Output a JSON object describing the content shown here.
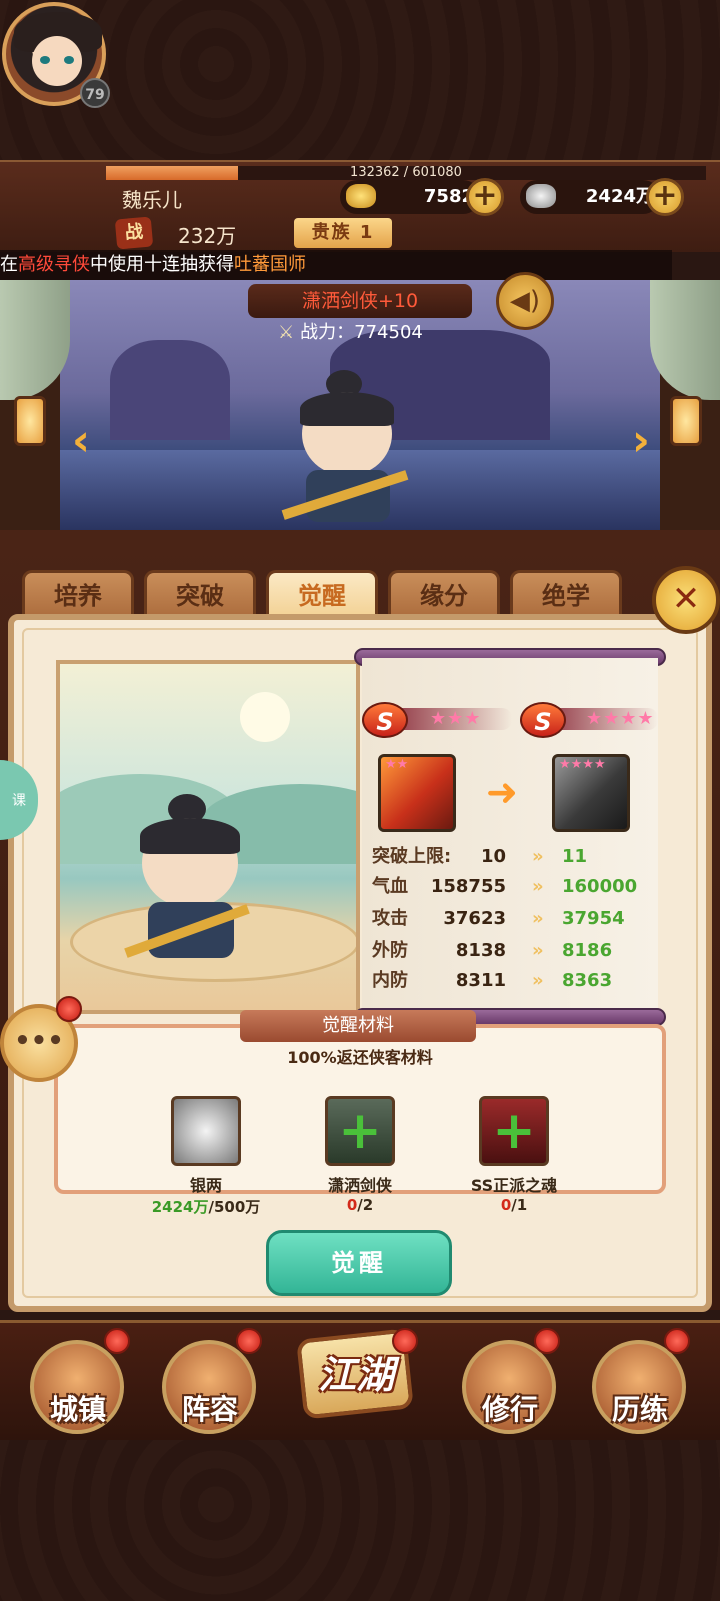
{
  "header": {
    "player_name": "魏乐儿",
    "level": "79",
    "exp_text": "132362 / 601080",
    "exp_fraction": 0.22,
    "gold_amount": "7582",
    "silver_amount": "2424万",
    "power_badge": "战",
    "power_value": "232万",
    "vip_label": "贵族 1"
  },
  "broadcast": {
    "prefix": "在",
    "location": "高级寻侠",
    "middle": "中使用十连抽获得",
    "reward": "吐蕃国师"
  },
  "hero": {
    "name_title": "潇洒剑侠+10",
    "combat_label": "战力：",
    "combat_value": "774504"
  },
  "tabs": [
    {
      "label": "培养"
    },
    {
      "label": "突破"
    },
    {
      "label": "觉醒"
    },
    {
      "label": "缘分"
    },
    {
      "label": "绝学"
    }
  ],
  "awaken": {
    "from_grade": "S",
    "from_stars": "★★★",
    "to_grade": "S",
    "to_stars": "★★★★",
    "item_from_stars": "★★",
    "item_to_stars": "★★★★",
    "stats": [
      {
        "label": "突破上限:",
        "old": "10",
        "new": "11"
      },
      {
        "label": "气血",
        "old": "158755",
        "new": "160000"
      },
      {
        "label": "攻击",
        "old": "37623",
        "new": "37954"
      },
      {
        "label": "外防",
        "old": "8138",
        "new": "8186"
      },
      {
        "label": "内防",
        "old": "8311",
        "new": "8363"
      }
    ]
  },
  "materials": {
    "title": "觉醒材料",
    "subtitle": "100%返还侠客材料",
    "items": [
      {
        "name": "银两",
        "have": "2424万",
        "need": "/500万"
      },
      {
        "name": "潇洒剑侠",
        "have": "0",
        "need": "/2"
      },
      {
        "name": "SS正派之魂",
        "have": "0",
        "need": "/1"
      }
    ]
  },
  "action_button": "觉醒",
  "bottom_nav": [
    {
      "label": "城镇"
    },
    {
      "label": "阵容"
    },
    {
      "label": "江湖"
    },
    {
      "label": "修行"
    },
    {
      "label": "历练"
    }
  ],
  "side_tab_label": "课",
  "icons": {
    "gold": "gold-ingot-icon",
    "silver": "silver-ingot-icon",
    "sound": "speaker-icon",
    "close": "close-sword-icon",
    "chat": "chat-bubble-icon"
  },
  "colors": {
    "accent": "#f3b03a",
    "gain_green": "#4aa630",
    "deficit_red": "#d32a1a",
    "button_teal": "#33b596"
  }
}
